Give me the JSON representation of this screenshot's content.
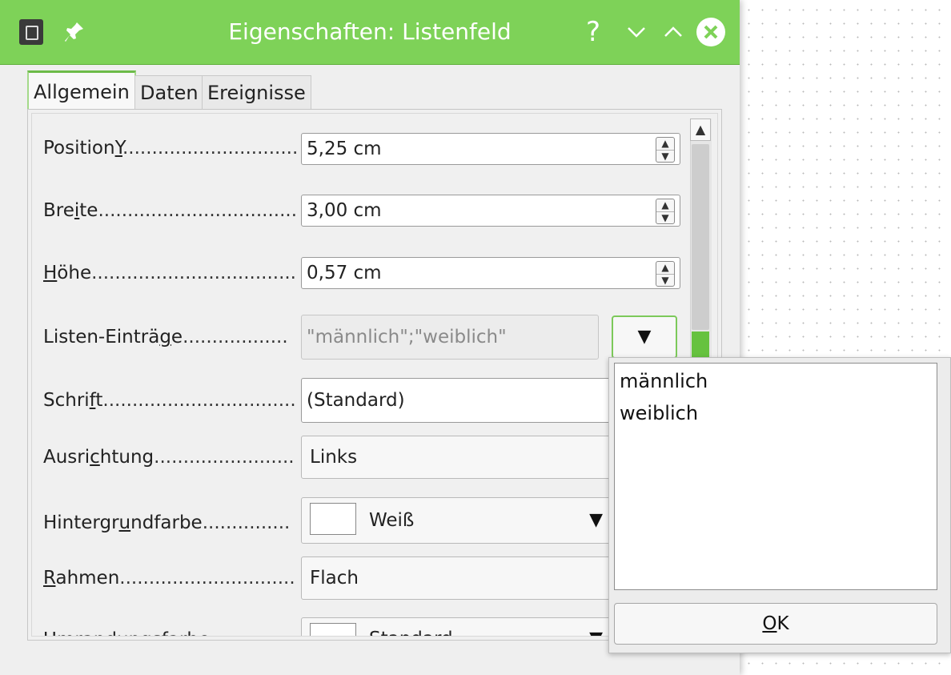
{
  "window": {
    "title": "Eigenschaften: Listenfeld",
    "help_label": "?",
    "icons": [
      "app-icon",
      "pin-icon",
      "minimize-icon",
      "maximize-icon",
      "close-icon"
    ],
    "accent_color": "#7ed258"
  },
  "tabs": [
    {
      "label": "Allgemein",
      "active": true
    },
    {
      "label": "Daten",
      "active": false
    },
    {
      "label": "Ereignisse",
      "active": false
    }
  ],
  "properties": {
    "position_y": {
      "pre": "Position",
      "mnemonic": "Y",
      "post": "",
      "dots": "...............................",
      "value": "5,25 cm"
    },
    "breite": {
      "pre": "Bre",
      "mnemonic": "i",
      "post": "te",
      "dots": "......................................",
      "value": "3,00 cm"
    },
    "hoehe": {
      "pre": "",
      "mnemonic": "H",
      "post": "öhe",
      "dots": "........................................",
      "value": "0,57 cm"
    },
    "listen_eintraege": {
      "pre": "Listen-Einträ",
      "mnemonic": "g",
      "post": "e",
      "dots": "..................",
      "value": "\"männlich\";\"weiblich\""
    },
    "schrift": {
      "pre": "Schri",
      "mnemonic": "f",
      "post": "t",
      "dots": ".....................................",
      "value": "(Standard)"
    },
    "ausrichtung": {
      "pre": "Ausri",
      "mnemonic": "c",
      "post": "htung",
      "dots": "...........................",
      "value": "Links"
    },
    "hintergrundfarbe": {
      "pre": "Hintergr",
      "mnemonic": "u",
      "post": "ndfarbe",
      "dots": "...............",
      "value": "Weiß"
    },
    "rahmen": {
      "pre": "",
      "mnemonic": "R",
      "post": "ahmen",
      "dots": "....................................",
      "value": "Flach"
    },
    "next_partial": {
      "label": "Umrandungsfarbe",
      "value": "Standard"
    }
  },
  "popup": {
    "lines": [
      "männlich",
      "weiblich"
    ],
    "ok_mnemonic": "O",
    "ok_rest": "K"
  }
}
